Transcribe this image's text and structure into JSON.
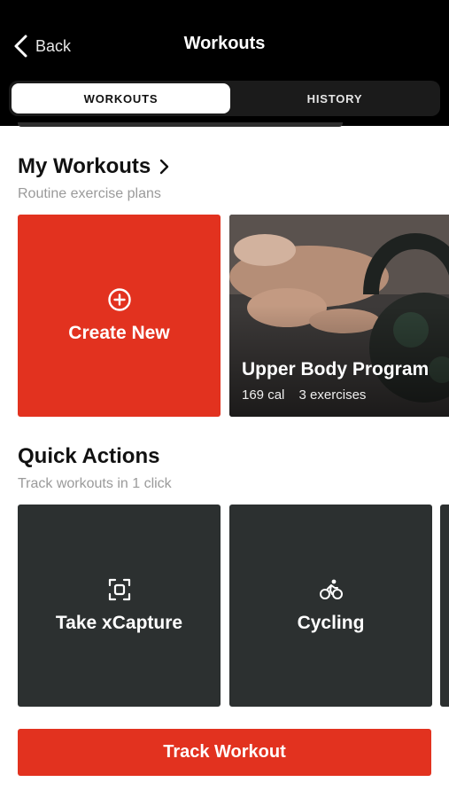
{
  "header": {
    "back_label": "Back",
    "title": "Workouts"
  },
  "tabs": [
    {
      "label": "WORKOUTS",
      "active": true
    },
    {
      "label": "HISTORY",
      "active": false
    }
  ],
  "my_workouts": {
    "title": "My Workouts",
    "subtitle": "Routine exercise plans",
    "create_label": "Create New",
    "program": {
      "name": "Upper Body Program",
      "calories": "169 cal",
      "exercises": "3 exercises"
    }
  },
  "quick_actions": {
    "title": "Quick Actions",
    "subtitle": "Track workouts in 1 click",
    "items": [
      {
        "label": "Take xCapture",
        "icon": "capture-icon"
      },
      {
        "label": "Cycling",
        "icon": "bicycle-icon"
      }
    ]
  },
  "footer": {
    "track_label": "Track Workout"
  },
  "colors": {
    "accent": "#e2321f",
    "header_bg": "#000000",
    "action_card": "#2c3030"
  }
}
